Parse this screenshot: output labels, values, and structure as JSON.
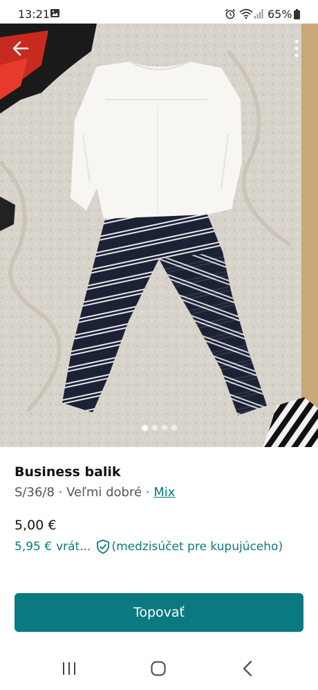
{
  "status_bar": {
    "time": "13:21",
    "battery": "65%",
    "icons": [
      "photo-icon",
      "alarm-icon",
      "wifi-icon",
      "signal-icon",
      "battery-icon"
    ]
  },
  "gallery": {
    "photo_count": 4,
    "active_index": 0,
    "icons": [
      "back-arrow-icon",
      "more-vertical-icon"
    ]
  },
  "item": {
    "title": "Business balik",
    "size_condition": "S/36/8 · Veľmi dobré · ",
    "brand": "Mix",
    "price": "5,00 €",
    "price_with_fee": "5,95 €",
    "fee_truncated": "vrát...",
    "buyer_protection": "(medzisúčet pre kupujúceho)"
  },
  "actions": {
    "bump_label": "Topovať"
  },
  "nav": {
    "icons": [
      "recents-icon",
      "home-icon",
      "back-icon"
    ]
  },
  "colors": {
    "accent": "#0b7a80",
    "text": "#111111",
    "muted": "#555555"
  }
}
